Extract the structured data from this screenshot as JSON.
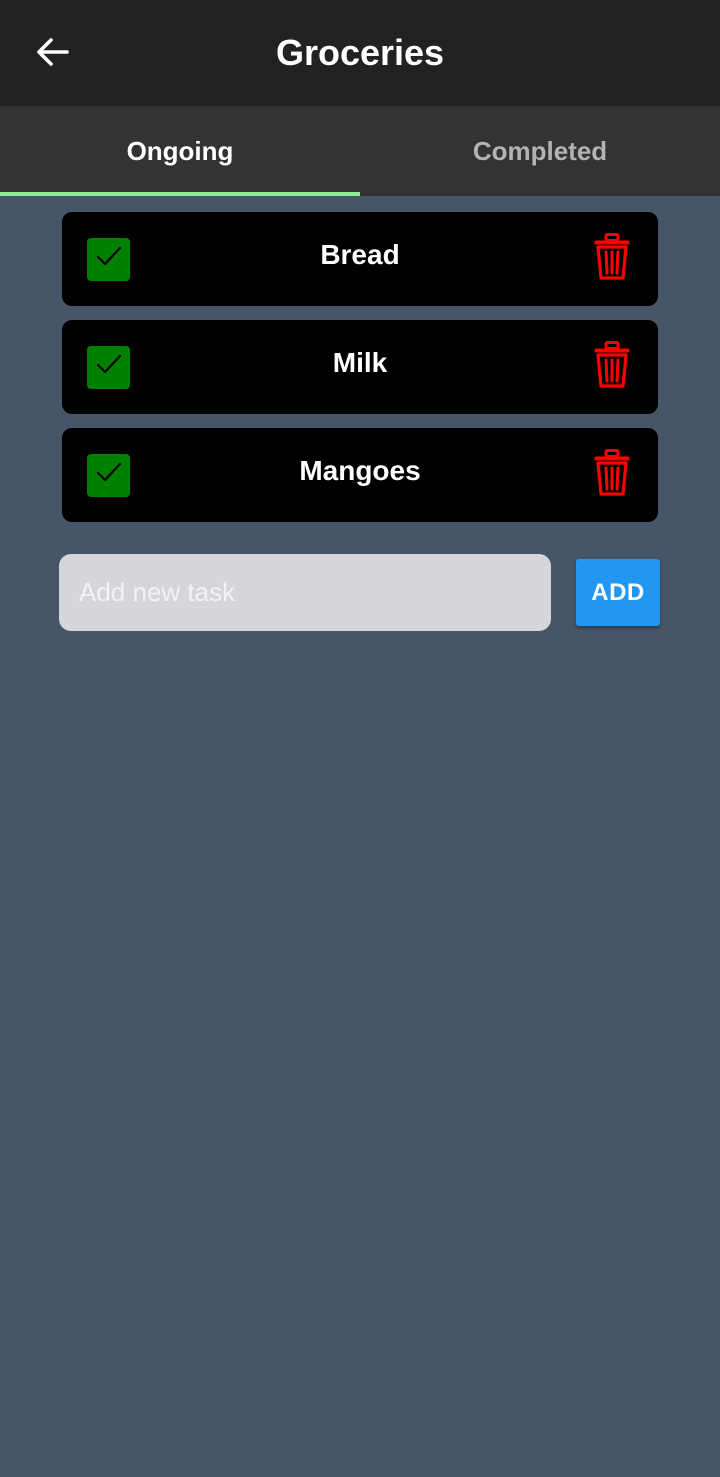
{
  "header": {
    "title": "Groceries",
    "back_icon": "arrow-left-icon",
    "background_color": "#222222"
  },
  "tabs": [
    {
      "label": "Ongoing",
      "active": true
    },
    {
      "label": "Completed",
      "active": false
    }
  ],
  "tab_indicator_color": "#90ee90",
  "tasks": [
    {
      "label": "Bread",
      "checked": true
    },
    {
      "label": "Milk",
      "checked": true
    },
    {
      "label": "Mangoes",
      "checked": true
    }
  ],
  "icons": {
    "checkbox": "checkmark-icon",
    "delete": "trash-icon"
  },
  "colors": {
    "background": "#475569",
    "card": "#000000",
    "checkbox": "#008000",
    "delete_icon": "#ff0000",
    "add_button": "#2196f3"
  },
  "new_task": {
    "placeholder": "Add new task",
    "value": "",
    "add_label": "ADD"
  }
}
